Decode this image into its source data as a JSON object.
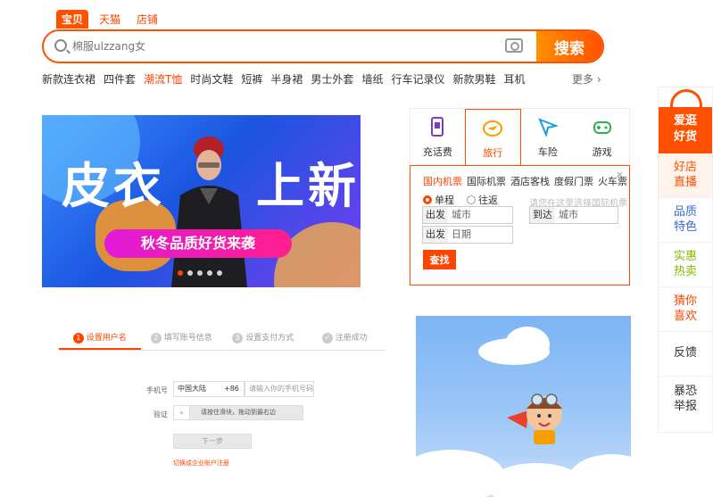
{
  "search": {
    "tabs": [
      "宝贝",
      "天猫",
      "店铺"
    ],
    "placeholder": "棉服ulzzang女",
    "button": "搜索"
  },
  "hot_words": [
    {
      "text": "新款连衣裙",
      "hl": false
    },
    {
      "text": "四件套",
      "hl": false
    },
    {
      "text": "潮流T恤",
      "hl": true
    },
    {
      "text": "时尚文鞋",
      "hl": false
    },
    {
      "text": "短裤",
      "hl": false
    },
    {
      "text": "半身裙",
      "hl": false
    },
    {
      "text": "男士外套",
      "hl": false
    },
    {
      "text": "墙纸",
      "hl": false
    },
    {
      "text": "行车记录仪",
      "hl": false
    },
    {
      "text": "新款男鞋",
      "hl": false
    },
    {
      "text": "耳机",
      "hl": false
    }
  ],
  "more": "更多 ›",
  "banner": {
    "left_text": "皮衣",
    "right_text": "上新",
    "subtitle": "秋冬品质好货来袭",
    "active_dot": 0,
    "dot_count": 5
  },
  "service": {
    "tabs": [
      "充话费",
      "旅行",
      "车险",
      "游戏"
    ],
    "active_tab": 1,
    "ticket_types": [
      "国内机票",
      "国际机票",
      "酒店客栈",
      "度假门票",
      "火车票"
    ],
    "close": "×",
    "trip_single": "单程",
    "trip_round": "往返",
    "depart_label": "出发",
    "depart_value": "城市",
    "arrive_label": "到达",
    "arrive_value": "城市",
    "date_label": "出发",
    "date_value": "日期",
    "hint": "请您在这里选择国际机票",
    "query_button": "查找"
  },
  "register": {
    "steps": [
      {
        "num": "1",
        "label": "设置用户名"
      },
      {
        "num": "2",
        "label": "填写账号信息"
      },
      {
        "num": "3",
        "label": "设置支付方式"
      },
      {
        "num": "✓",
        "label": "注册成功"
      }
    ],
    "phone_label": "手机号",
    "country": "中国大陆",
    "code": "+86",
    "phone_placeholder": "请输入你的手机号码",
    "verify_label": "验证",
    "slider_text": "请按住滑块，拖动到最右边",
    "next_button": "下一步",
    "enterprise_link": "切换成企业账户注册"
  },
  "sidebar": {
    "head": [
      "爱逛",
      "好货"
    ],
    "items": [
      [
        "好店",
        "直播"
      ],
      [
        "品质",
        "特色"
      ],
      [
        "实惠",
        "热卖"
      ],
      [
        "猜你",
        "喜欢"
      ],
      [
        "反馈"
      ],
      [
        "暴恐",
        "举报"
      ]
    ]
  },
  "colors": {
    "accent": "#ff5000",
    "blue": "#3a6ad4",
    "green": "#7fb800"
  }
}
